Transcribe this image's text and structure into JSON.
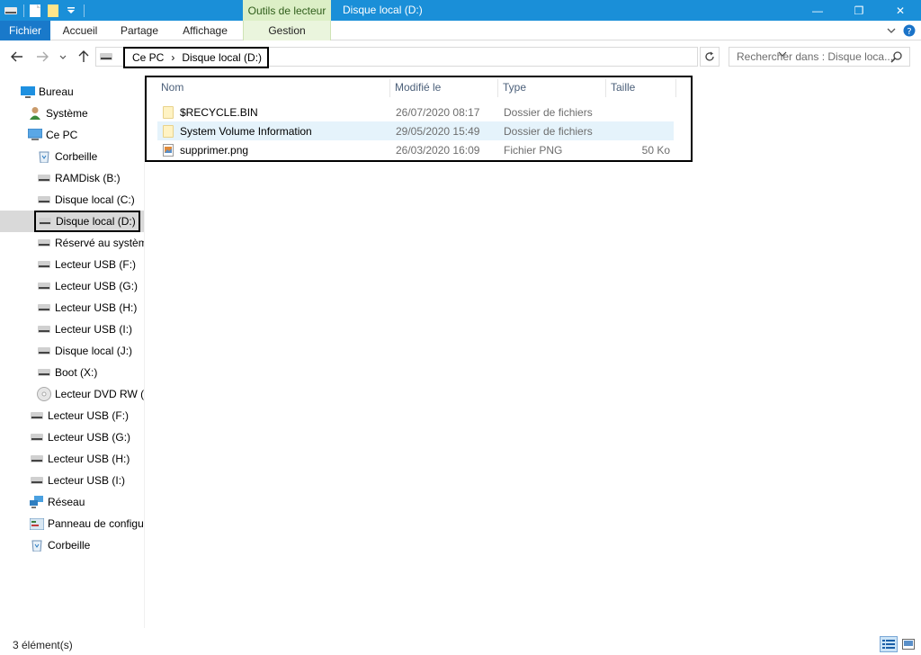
{
  "titlebar": {
    "context_tab": "Outils de lecteur",
    "window_title": "Disque local (D:)",
    "controls": {
      "minimize": "—",
      "maximize": "❐",
      "close": "✕"
    }
  },
  "ribbon": {
    "tabs": [
      "Fichier",
      "Accueil",
      "Partage",
      "Affichage",
      "Gestion"
    ]
  },
  "address": {
    "crumbs": [
      "Ce PC",
      "Disque local (D:)"
    ],
    "separator": "›"
  },
  "search": {
    "placeholder": "Rechercher dans : Disque loca..."
  },
  "nav": [
    {
      "label": "Bureau",
      "icon": "desktop-icon"
    },
    {
      "label": "Système",
      "icon": "user-icon"
    },
    {
      "label": "Ce PC",
      "icon": "computer-icon"
    },
    {
      "label": "Corbeille",
      "icon": "recycle-bin-icon"
    },
    {
      "label": "RAMDisk (B:)",
      "icon": "drive-icon"
    },
    {
      "label": "Disque local (C:)",
      "icon": "drive-icon"
    },
    {
      "label": "Disque local (D:)",
      "icon": "drive-icon"
    },
    {
      "label": "Réservé au systèm",
      "icon": "drive-icon"
    },
    {
      "label": "Lecteur USB (F:)",
      "icon": "drive-icon"
    },
    {
      "label": "Lecteur USB (G:)",
      "icon": "drive-icon"
    },
    {
      "label": "Lecteur USB (H:)",
      "icon": "drive-icon"
    },
    {
      "label": "Lecteur USB (I:)",
      "icon": "drive-icon"
    },
    {
      "label": "Disque local (J:)",
      "icon": "drive-icon"
    },
    {
      "label": "Boot (X:)",
      "icon": "drive-icon"
    },
    {
      "label": "Lecteur DVD RW (",
      "icon": "dvd-icon"
    },
    {
      "label": "Lecteur USB (F:)",
      "icon": "drive-icon"
    },
    {
      "label": "Lecteur USB (G:)",
      "icon": "drive-icon"
    },
    {
      "label": "Lecteur USB (H:)",
      "icon": "drive-icon"
    },
    {
      "label": "Lecteur USB (I:)",
      "icon": "drive-icon"
    },
    {
      "label": "Réseau",
      "icon": "network-icon"
    },
    {
      "label": "Panneau de configu",
      "icon": "control-panel-icon"
    },
    {
      "label": "Corbeille",
      "icon": "recycle-bin-icon"
    }
  ],
  "files": {
    "columns": [
      "Nom",
      "Modifié le",
      "Type",
      "Taille"
    ],
    "rows": [
      {
        "name": "$RECYCLE.BIN",
        "modified": "26/07/2020 08:17",
        "type": "Dossier de fichiers",
        "size": "",
        "icon": "folder-icon"
      },
      {
        "name": "System Volume Information",
        "modified": "29/05/2020 15:49",
        "type": "Dossier de fichiers",
        "size": "",
        "icon": "folder-icon"
      },
      {
        "name": "supprimer.png",
        "modified": "26/03/2020 16:09",
        "type": "Fichier PNG",
        "size": "50 Ko",
        "icon": "image-file-icon"
      }
    ]
  },
  "status": {
    "count": "3 élément(s)"
  },
  "colors": {
    "titlebar": "#1a8fd8",
    "file_tab": "#1979ca",
    "context": "#dcefc6",
    "selection": "#d9d9d9",
    "row_hover": "#e5f3fb"
  }
}
